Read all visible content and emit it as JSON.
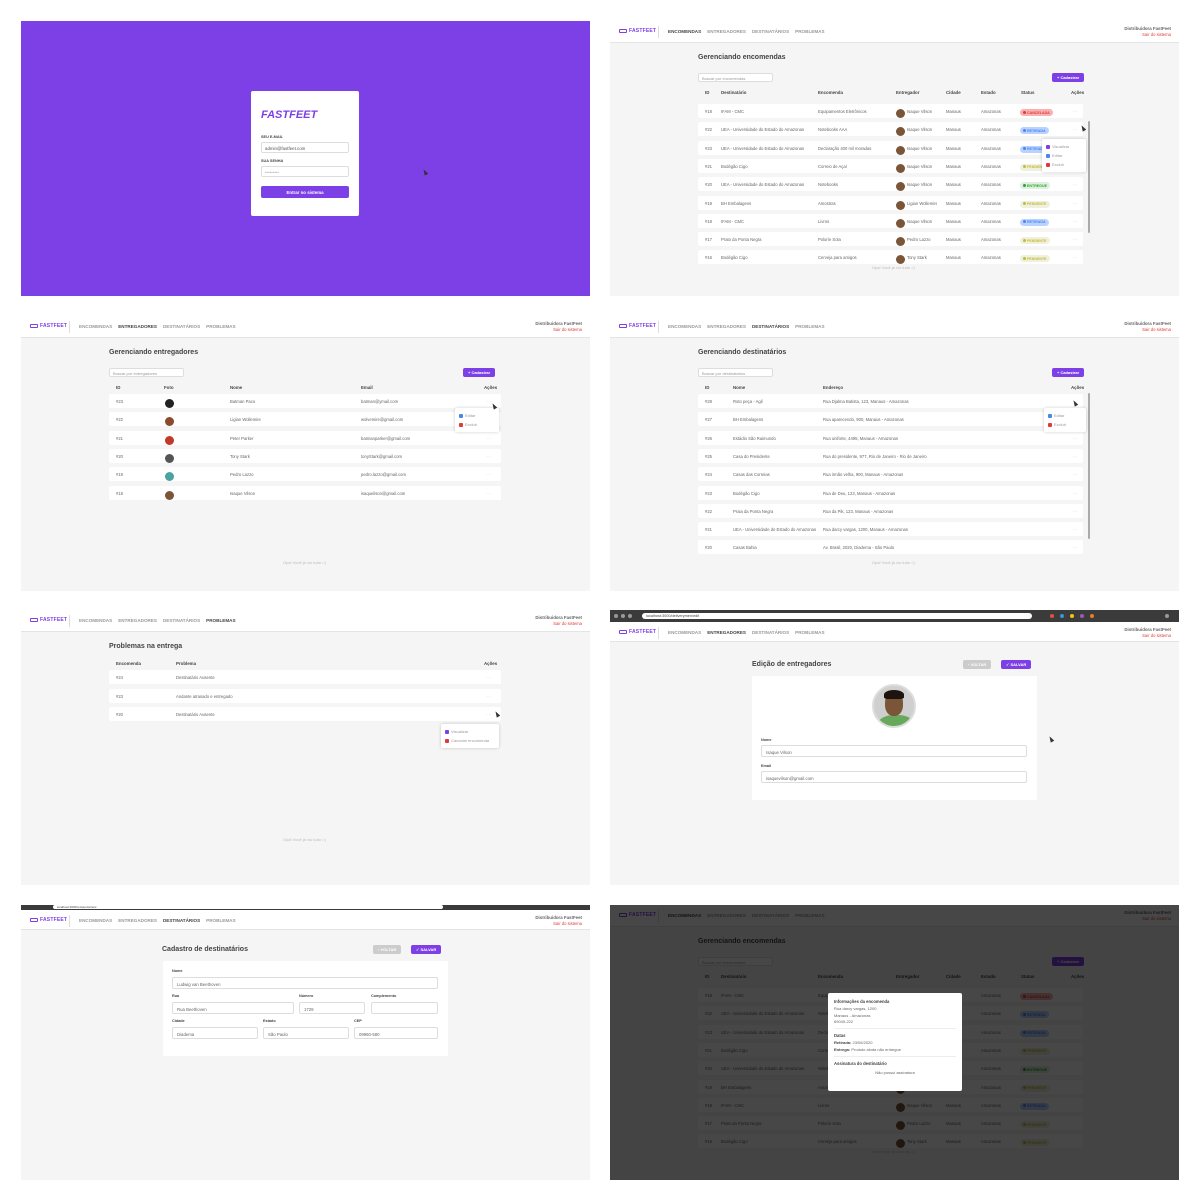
{
  "brand": {
    "logo": "FASTFEET",
    "accent": "#7d40e7",
    "danger": "#de3b3b"
  },
  "nav": {
    "items": [
      "ENCOMENDAS",
      "ENTREGADORES",
      "DESTINATÁRIOS",
      "PROBLEMAS"
    ],
    "user_name": "Distribuidora FastFeet",
    "logout": "Sair do sistema"
  },
  "login": {
    "email_label": "SEU E-MAIL",
    "email_value": "admin@fastfeet.com",
    "password_label": "SUA SENHA",
    "password_value": "•••••••••",
    "submit": "Entrar no sistema"
  },
  "common": {
    "register_button": "+ Cadastrar",
    "actions_header": "Ações",
    "footnote": "Opa! Você já viu tudo =)",
    "back_button": "‹ VOLTAR",
    "save_button": "✓ SALVAR"
  },
  "orders": {
    "title": "Gerenciando encomendas",
    "search_placeholder": "Buscar por encomendas",
    "columns": [
      "ID",
      "Destinatário",
      "Encomenda",
      "Entregador",
      "Cidade",
      "Estado",
      "Status",
      "Ações"
    ],
    "rows": [
      {
        "id": "#18",
        "recipient": "IFAM - CMC",
        "product": "Equipamentos Eletrônicos",
        "courier": "Isaque Vilson",
        "city": "Manaus",
        "state": "Amazonas",
        "status": "CANCELADA",
        "status_color": "#de3b3b",
        "status_bg": "#fab0b0"
      },
      {
        "id": "#22",
        "recipient": "UEA - Universidade do Estado do Amazonas",
        "product": "Notebooks AAA",
        "courier": "Isaque Vilson",
        "city": "Manaus",
        "state": "Amazonas",
        "status": "RETIRADA",
        "status_color": "#4d85ee",
        "status_bg": "#bad2ff"
      },
      {
        "id": "#23",
        "recipient": "UEA - Universidade do Estado do Amazonas",
        "product": "Declaração 400 mil moradas",
        "courier": "Isaque Vilson",
        "city": "Manaus",
        "state": "Amazonas",
        "status": "RETIRADA",
        "status_color": "#4d85ee",
        "status_bg": "#bad2ff"
      },
      {
        "id": "#21",
        "recipient": "Bodégão Cigo",
        "product": "Correio de Açaí",
        "courier": "Isaque Vilson",
        "city": "Manaus",
        "state": "Amazonas",
        "status": "PENDENTE",
        "status_color": "#c1bc35",
        "status_bg": "#f0f0df"
      },
      {
        "id": "#20",
        "recipient": "UEA - Universidade do Estado do Amazonas",
        "product": "Notebooks",
        "courier": "Isaque Vilson",
        "city": "Manaus",
        "state": "Amazonas",
        "status": "ENTREGUE",
        "status_color": "#2ca42b",
        "status_bg": "#dff0df"
      },
      {
        "id": "#19",
        "recipient": "BH Embalagens",
        "product": "Amostras",
        "courier": "Ligian Wollemire",
        "city": "Manaus",
        "state": "Amazonas",
        "status": "PENDENTE",
        "status_color": "#c1bc35",
        "status_bg": "#f0f0df"
      },
      {
        "id": "#18",
        "recipient": "IFAM - CMC",
        "product": "Livros",
        "courier": "Isaque Vilson",
        "city": "Manaus",
        "state": "Amazonas",
        "status": "RETIRADA",
        "status_color": "#4d85ee",
        "status_bg": "#bad2ff"
      },
      {
        "id": "#17",
        "recipient": "Prato da Ponta Negra",
        "product": "Poloríe Sola",
        "courier": "Pedro Lazzo",
        "city": "Manaus",
        "state": "Amazonas",
        "status": "PENDENTE",
        "status_color": "#c1bc35",
        "status_bg": "#f0f0df"
      },
      {
        "id": "#16",
        "recipient": "Bodégão Cigo",
        "product": "Cerveja para amigos",
        "courier": "Tony Stark",
        "city": "Manaus",
        "state": "Amazonas",
        "status": "PENDENTE",
        "status_color": "#c1bc35",
        "status_bg": "#f0f0df"
      }
    ],
    "menu": [
      "Visualizar",
      "Editar",
      "Excluir"
    ]
  },
  "couriers": {
    "title": "Gerenciando entregadores",
    "search_placeholder": "Buscar por entregadores",
    "columns": [
      "ID",
      "Foto",
      "Nome",
      "Email",
      "Ações"
    ],
    "rows": [
      {
        "id": "#23",
        "name": "Batman Paco",
        "email": "batman@ymail.com",
        "avatar": "#222222"
      },
      {
        "id": "#22",
        "name": "Ligian Wollemire",
        "email": "wolvemire@gmail.com",
        "avatar": "#8a4a2e"
      },
      {
        "id": "#21",
        "name": "Peter Parker",
        "email": "batmanparker@gmail.com",
        "avatar": "#c0392b"
      },
      {
        "id": "#20",
        "name": "Tony Stark",
        "email": "tonyStark@gmail.com",
        "avatar": "#555555"
      },
      {
        "id": "#19",
        "name": "Pedro Lazzo",
        "email": "pedro.lazzo@gmail.com",
        "avatar": "#4aa3a0"
      },
      {
        "id": "#18",
        "name": "Isaque Vilson",
        "email": "isaqueilson@gmail.com",
        "avatar": "#7a5537"
      }
    ],
    "menu": [
      "Editar",
      "Excluir"
    ]
  },
  "recipients": {
    "title": "Gerenciando destinatários",
    "search_placeholder": "Buscar por destinatários",
    "columns": [
      "ID",
      "Nome",
      "Endereço",
      "Ações"
    ],
    "rows": [
      {
        "id": "#28",
        "name": "Roto peça - Agil",
        "address": "Rua Djalma Batista, 123, Manaus - Amazonas"
      },
      {
        "id": "#27",
        "name": "BH Embalagens",
        "address": "Rua aparecendo, 900, Manaus - Amazonas"
      },
      {
        "id": "#26",
        "name": "Estádio São Raimundo",
        "address": "Rua uniforte, 4495, Manaus - Amazonas"
      },
      {
        "id": "#25",
        "name": "Casa do Presidente",
        "address": "Rua do presidente, 977, Rio de Janeiro - Rio de Janeiro"
      },
      {
        "id": "#24",
        "name": "Casas das Correias",
        "address": "Rua irmão velha, 900, Manaus - Amazonas"
      },
      {
        "id": "#23",
        "name": "Bodégão Cigo",
        "address": "Rua de Deu, 123, Manaus - Amazonas"
      },
      {
        "id": "#22",
        "name": "Praia da Ponta Negra",
        "address": "Rua da Pik, 123, Manaus - Amazonas"
      },
      {
        "id": "#21",
        "name": "UEA - Universidade do Estado do Amazonas",
        "address": "Rua darcy vargas, 1200, Manaus - Amazonas"
      },
      {
        "id": "#20",
        "name": "Casas Bahia",
        "address": "Av. Brasil, 2020, Diadema - São Paulo"
      }
    ],
    "menu": [
      "Editar",
      "Excluir"
    ]
  },
  "problems": {
    "title": "Problemas na entrega",
    "columns": [
      "Encomenda",
      "Problema",
      "Ações"
    ],
    "rows": [
      {
        "id": "#24",
        "problem": "Destinatário Ausente"
      },
      {
        "id": "#23",
        "problem": "Andante atrasado e entregado"
      },
      {
        "id": "#20",
        "problem": "Destinatário Ausente"
      }
    ],
    "menu": [
      "Visualizar",
      "Cancelar encomenda"
    ]
  },
  "courier_edit": {
    "url": "localhost:3000/deliverymen/edit",
    "title": "Edição de entregadores",
    "name_label": "Nome",
    "name_value": "Isaque Vilson",
    "email_label": "Email",
    "email_value": "isaquevilson@gmail.com"
  },
  "recipient_form": {
    "url": "localhost:3000/recipients/new",
    "title": "Cadastro de destinatários",
    "name_label": "Nome",
    "name_value": "Ludwig van Beethoven",
    "street_label": "Rua",
    "street_value": "Rua Beethoven",
    "number_label": "Número",
    "number_value": "1729",
    "complement_label": "Complemento",
    "complement_value": "",
    "city_label": "Cidade",
    "city_value": "Diadema",
    "state_label": "Estado",
    "state_value": "São Paulo",
    "zip_label": "CEP",
    "zip_value": "09960-580"
  },
  "order_modal": {
    "heading": "Informações da encomenda",
    "address_line1": "Rua darcy vargas, 1200",
    "address_line2": "Manaus - Amazonas",
    "address_line3": "69049-222",
    "dates_heading": "Datas",
    "pickup_label": "Retirada:",
    "pickup_value": "23/06/2020",
    "delivery_label": "Entrega:",
    "delivery_value": "Produto ainda não entregue",
    "signature_heading": "Assinatura do destinatário",
    "signature_value": "Não possui assinatura"
  }
}
